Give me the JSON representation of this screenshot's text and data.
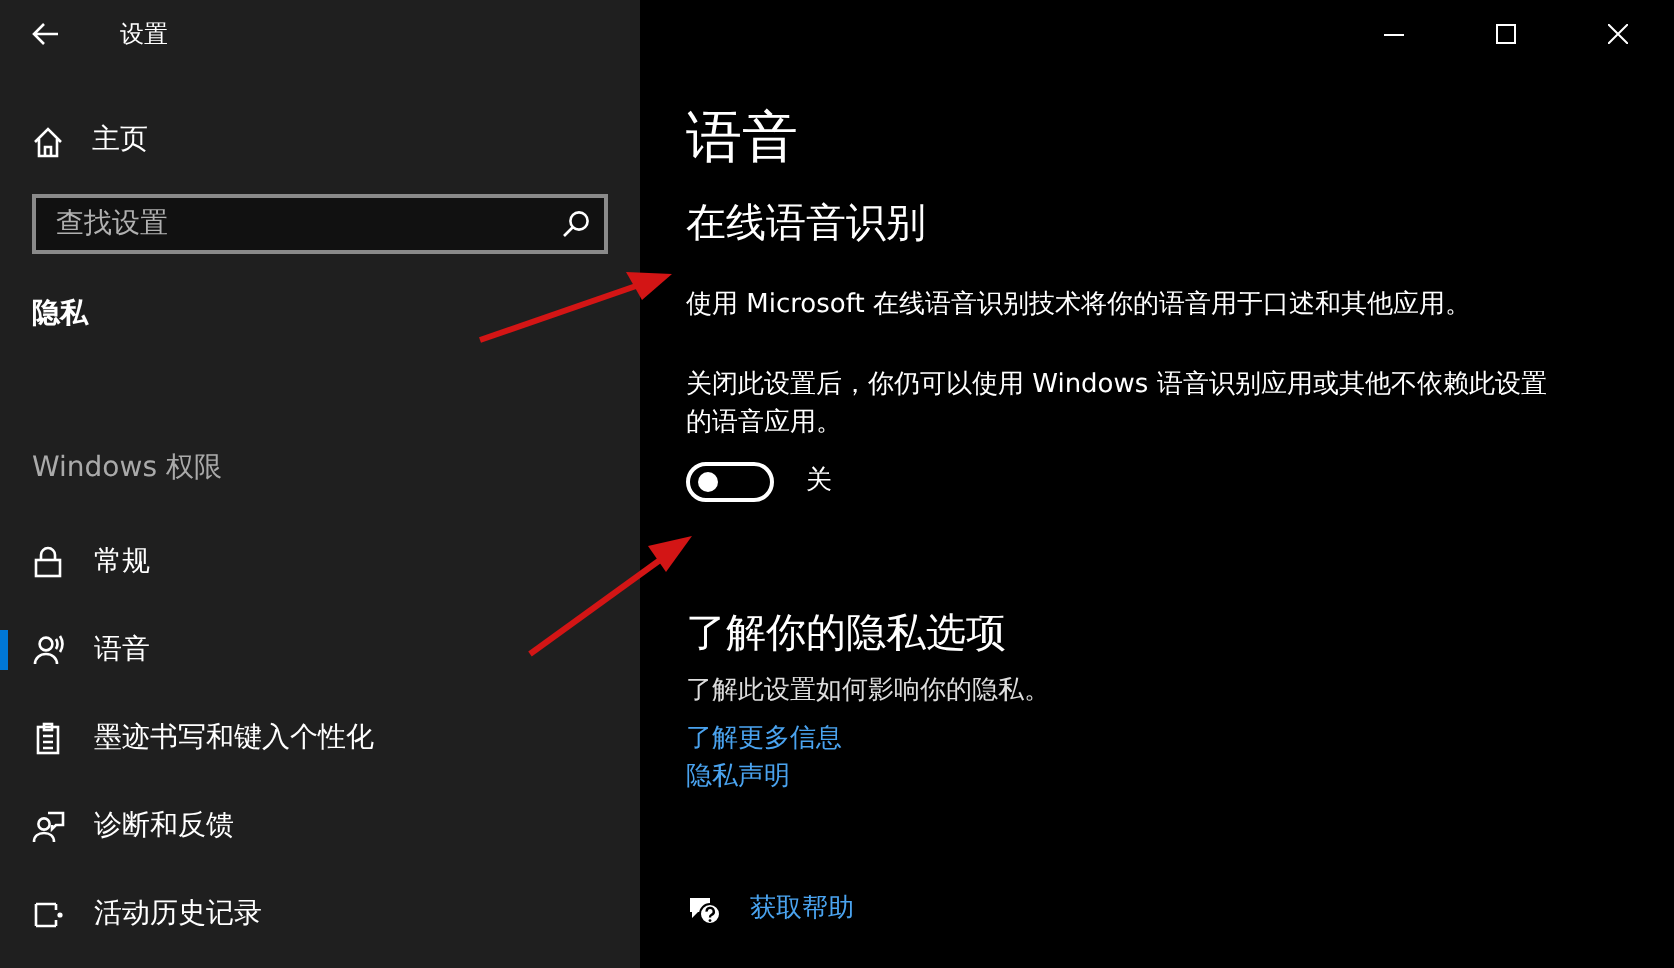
{
  "window": {
    "title": "设置"
  },
  "sidebar": {
    "home": "主页",
    "search": {
      "placeholder": "查找设置"
    },
    "section": "隐私",
    "group": "Windows 权限",
    "items": [
      {
        "label": "常规",
        "selected": false
      },
      {
        "label": "语音",
        "selected": true
      },
      {
        "label": "墨迹书写和键入个性化",
        "selected": false
      },
      {
        "label": "诊断和反馈",
        "selected": false
      },
      {
        "label": "活动历史记录",
        "selected": false
      }
    ]
  },
  "main": {
    "title": "语音",
    "heading": "在线语音识别",
    "description": "使用 Microsoft 在线语音识别技术将你的语音用于口述和其他应用。",
    "note": "关闭此设置后，你仍可以使用 Windows 语音识别应用或其他不依赖此设置的语音应用。",
    "toggle": {
      "on": false,
      "label": "关"
    },
    "privacy": {
      "heading": "了解你的隐私选项",
      "text": "了解此设置如何影响你的隐私。",
      "links": [
        "了解更多信息",
        "隐私声明"
      ]
    },
    "help": "获取帮助"
  }
}
